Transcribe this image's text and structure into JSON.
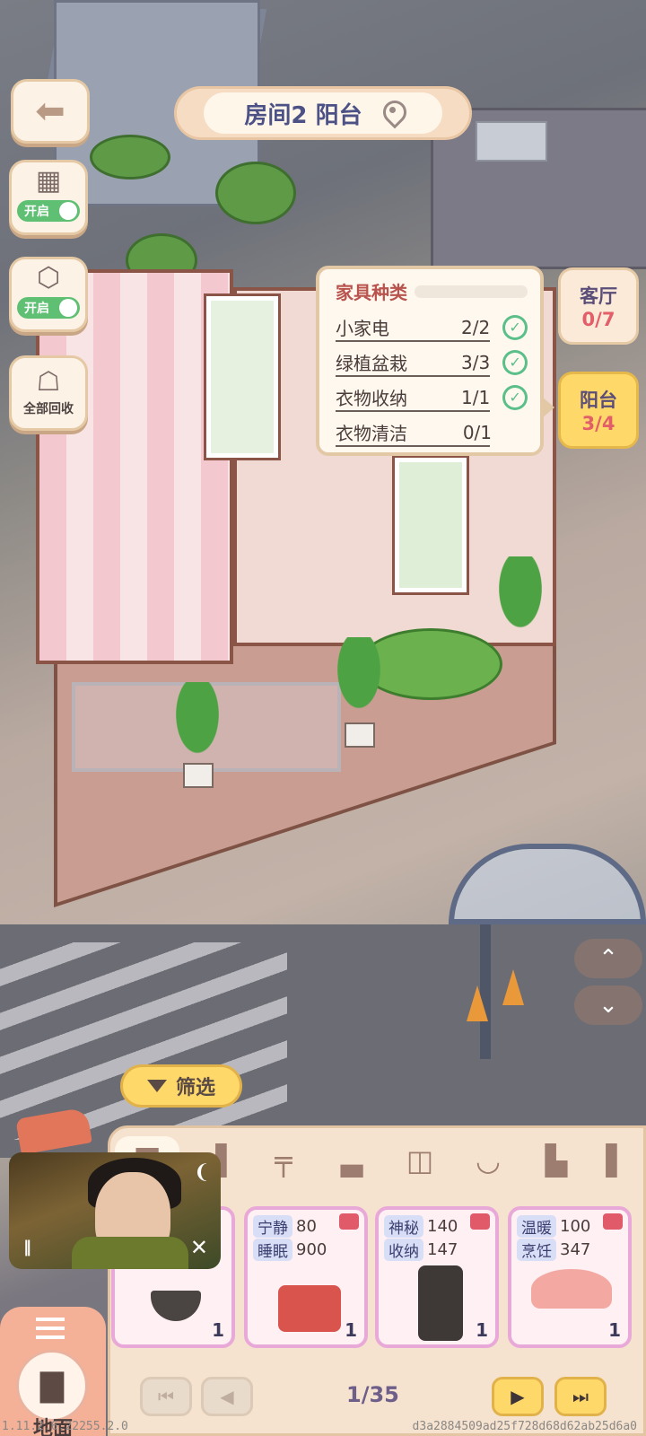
{
  "header": {
    "room_title": "房间2 阳台",
    "location_icon": "location-pin-icon",
    "back_icon": "back-arrow-icon"
  },
  "tools": [
    {
      "icon": "wall-brick-icon",
      "toggle_label": "开启"
    },
    {
      "icon": "cube-box-icon",
      "toggle_label": "开启"
    },
    {
      "icon": "basket-recycle-icon",
      "label": "全部回收"
    }
  ],
  "furniture_popup": {
    "title": "家具种类",
    "rows": [
      {
        "name": "小家电",
        "count": "2/2",
        "done": true
      },
      {
        "name": "绿植盆栽",
        "count": "3/3",
        "done": true
      },
      {
        "name": "衣物收纳",
        "count": "1/1",
        "done": true
      },
      {
        "name": "衣物清洁",
        "count": "0/1",
        "done": false
      }
    ]
  },
  "room_tabs": [
    {
      "name": "客厅",
      "progress": "0/7",
      "active": false
    },
    {
      "name": "阳台",
      "progress": "3/4",
      "active": true
    }
  ],
  "scroll": {
    "up_icon": "chevron-up-icon",
    "down_icon": "chevron-down-icon"
  },
  "filter": {
    "label": "筛选",
    "icon": "funnel-icon"
  },
  "categories": [
    {
      "icon": "sofa-icon",
      "selected": true
    },
    {
      "icon": "bed-side-icon"
    },
    {
      "icon": "table-icon"
    },
    {
      "icon": "bed-icon"
    },
    {
      "icon": "wardrobe-icon"
    },
    {
      "icon": "pot-icon"
    },
    {
      "icon": "toilet-icon"
    },
    {
      "icon": "chair-icon"
    }
  ],
  "cards": [
    {
      "qty": "1",
      "stats": []
    },
    {
      "qty": "1",
      "stats": [
        {
          "tag": "宁静",
          "value": "80"
        },
        {
          "tag": "睡眠",
          "value": "900"
        }
      ]
    },
    {
      "qty": "1",
      "stats": [
        {
          "tag": "神秘",
          "value": "140"
        },
        {
          "tag": "收纳",
          "value": "147"
        }
      ]
    },
    {
      "qty": "1",
      "stats": [
        {
          "tag": "温暖",
          "value": "100"
        },
        {
          "tag": "烹饪",
          "value": "347"
        }
      ]
    }
  ],
  "pager": {
    "page": "1/35",
    "first_icon": "skip-first-icon",
    "prev_icon": "prev-icon",
    "next_icon": "next-icon",
    "last_icon": "skip-last-icon"
  },
  "floor_tab": {
    "label": "地面",
    "menu_icon": "menu-icon",
    "icon": "sofa-icon"
  },
  "video_overlay": {
    "hint_icon": "hearing-icon",
    "pause_icon": "pause-icon",
    "close_icon": "close-icon"
  },
  "footer": {
    "version": "1.11.2.6.22255.2.0",
    "hash": "d3a2884509ad25f728d68d62ab25d6a0"
  },
  "colors": {
    "accent_yellow": "#ffd86a",
    "title_text": "#4c5186",
    "progress_red": "#e25e69",
    "check_green": "#5bbf8a",
    "toggle_green": "#5fbf73"
  }
}
